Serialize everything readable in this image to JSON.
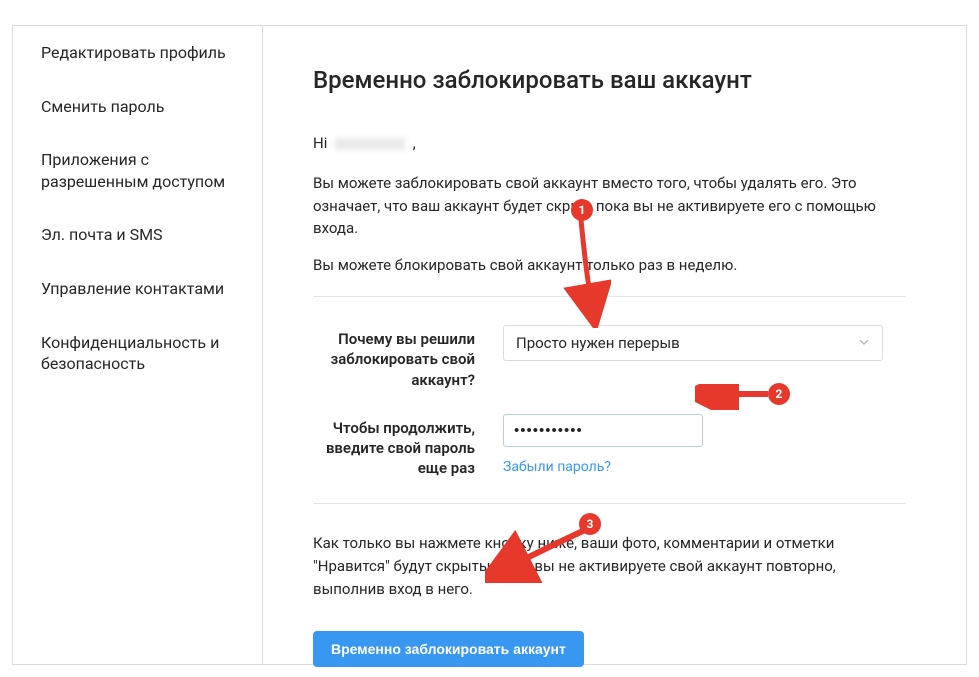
{
  "sidebar": {
    "items": [
      {
        "label": "Редактировать профиль"
      },
      {
        "label": "Сменить пароль"
      },
      {
        "label": "Приложения с разрешенным доступом"
      },
      {
        "label": "Эл. почта и SMS"
      },
      {
        "label": "Управление контактами"
      },
      {
        "label": "Конфиденциальность и безопасность"
      }
    ]
  },
  "main": {
    "title": "Временно заблокировать ваш аккаунт",
    "greeting_prefix": "Hi ",
    "greeting_suffix": " ,",
    "info1": "Вы можете заблокировать свой аккаунт вместо того, чтобы удалять его. Это означает, что ваш аккаунт будет скрыт, пока вы не активируете его с помощью входа.",
    "info2": "Вы можете блокировать свой аккаунт только раз в неделю.",
    "reason_label": "Почему вы решили заблокировать свой аккаунт?",
    "reason_value": "Просто нужен перерыв",
    "password_label": "Чтобы продолжить, введите свой пароль еще раз",
    "password_value": "●●●●●●●●●●●",
    "forgot_link": "Забыли пароль?",
    "final_info": "Как только вы нажмете кнопку ниже, ваши фото, комментарии и отметки \"Нравится\" будут скрыты, пока вы не активируете свой аккаунт повторно, выполнив вход в него.",
    "submit_label": "Временно заблокировать аккаунт"
  },
  "annotations": {
    "badge1": "1",
    "badge2": "2",
    "badge3": "3"
  }
}
